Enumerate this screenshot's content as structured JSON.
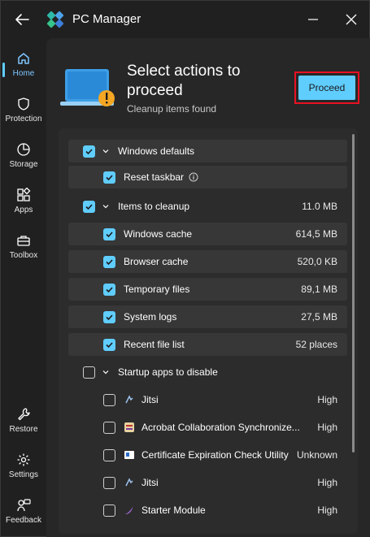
{
  "app": {
    "title": "PC Manager"
  },
  "sidebar": {
    "items": [
      {
        "label": "Home",
        "icon": "home-icon",
        "active": true
      },
      {
        "label": "Protection",
        "icon": "shield-icon"
      },
      {
        "label": "Storage",
        "icon": "pie-chart-icon"
      },
      {
        "label": "Apps",
        "icon": "apps-grid-icon"
      },
      {
        "label": "Toolbox",
        "icon": "toolbox-icon"
      }
    ],
    "bottom_items": [
      {
        "label": "Restore",
        "icon": "wrench-icon"
      },
      {
        "label": "Settings",
        "icon": "gear-icon"
      },
      {
        "label": "Feedback",
        "icon": "feedback-icon"
      }
    ]
  },
  "header": {
    "title": "Select actions to proceed",
    "subtitle": "Cleanup items found",
    "proceed_label": "Proceed"
  },
  "list": {
    "windows_defaults": {
      "label": "Windows defaults",
      "checked": true
    },
    "reset_taskbar": {
      "label": "Reset taskbar",
      "checked": true
    },
    "items_to_cleanup": {
      "label": "Items to cleanup",
      "value": "11.0 MB",
      "checked": true
    },
    "cleanup_items": [
      {
        "label": "Windows cache",
        "value": "614,5 MB",
        "checked": true
      },
      {
        "label": "Browser cache",
        "value": "520,0 KB",
        "checked": true
      },
      {
        "label": "Temporary files",
        "value": "89,1 MB",
        "checked": true
      },
      {
        "label": "System logs",
        "value": "27,5 MB",
        "checked": true
      },
      {
        "label": "Recent file list",
        "value": "52 places",
        "checked": true
      }
    ],
    "startup_apps": {
      "label": "Startup apps to disable",
      "checked": false
    },
    "startup_items": [
      {
        "label": "Jitsi",
        "value": "High",
        "checked": false,
        "icon": "jitsi-icon"
      },
      {
        "label": "Acrobat Collaboration Synchronize...",
        "value": "High",
        "checked": false,
        "icon": "acrobat-icon"
      },
      {
        "label": "Certificate Expiration Check Utility",
        "value": "Unknown",
        "checked": false,
        "icon": "certificate-icon"
      },
      {
        "label": "Jitsi",
        "value": "High",
        "checked": false,
        "icon": "jitsi-icon"
      },
      {
        "label": "Starter Module",
        "value": "High",
        "checked": false,
        "icon": "starter-module-icon"
      }
    ]
  },
  "colors": {
    "accent": "#60cdff",
    "highlight": "#e81123",
    "warning": "#f5a623"
  }
}
